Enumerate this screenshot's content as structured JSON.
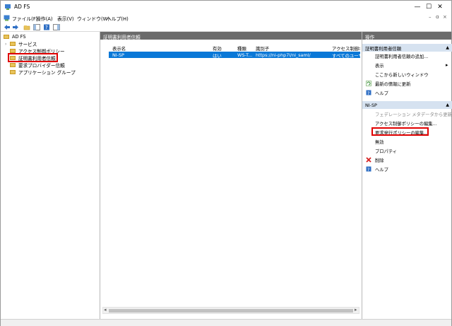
{
  "window": {
    "title": "AD FS",
    "minimize_glyph": "—",
    "maximize_glyph": "☐",
    "close_glyph": "✕"
  },
  "menubar": {
    "items": [
      "ファイル(F)",
      "操作(A)",
      "表示(V)",
      "ウィンドウ(W)",
      "ヘルプ(H)"
    ],
    "mdi_minimize": "–",
    "mdi_restore": "ɑ",
    "mdi_close": "×"
  },
  "tree": {
    "root": "AD FS",
    "items": [
      {
        "label": "サービス",
        "expandable": true
      },
      {
        "label": "アクセス制御ポリシー",
        "expandable": false
      },
      {
        "label": "証明書利用者信頼",
        "expandable": false,
        "highlighted": true
      },
      {
        "label": "要求プロバイダー信頼",
        "expandable": false
      },
      {
        "label": "アプリケーション グループ",
        "expandable": false
      }
    ]
  },
  "center": {
    "title": "証明書利用者信頼",
    "columns": [
      "表示名",
      "有効",
      "種類",
      "識別子",
      "アクセス制御ポ"
    ],
    "rows": [
      {
        "name": "NI-SP",
        "enabled": "はい",
        "type": "WS-T...",
        "identifier": "https://ni-php7l/ni_saml/",
        "access": "すべてのユーザ"
      }
    ],
    "scroll_left": "◂",
    "scroll_right": "▸"
  },
  "actions": {
    "header": "操作",
    "section1": {
      "title": "証明書利用者信頼",
      "items": [
        {
          "label": "証明書利用者信頼の追加...",
          "icon": ""
        },
        {
          "label": "表示",
          "icon": "",
          "submenu": true
        },
        {
          "label": "ここから新しいウィンドウ",
          "icon": ""
        },
        {
          "label": "最新の情報に更新",
          "icon": "refresh-icon"
        },
        {
          "label": "ヘルプ",
          "icon": "help-icon"
        }
      ]
    },
    "section2": {
      "title": "NI-SP",
      "items": [
        {
          "label": "フェデレーション メタデータから更新...",
          "icon": "",
          "disabled": true
        },
        {
          "label": "アクセス制御ポリシーの編集...",
          "icon": ""
        },
        {
          "label": "要求発行ポリシーの編集...",
          "icon": "",
          "highlighted": true
        },
        {
          "label": "無効",
          "icon": ""
        },
        {
          "label": "プロパティ",
          "icon": ""
        },
        {
          "label": "削除",
          "icon": "delete-icon"
        },
        {
          "label": "ヘルプ",
          "icon": "help-icon"
        }
      ]
    },
    "collapse_glyph": "▲",
    "submenu_glyph": "▸"
  },
  "colors": {
    "selection": "#0a78d7",
    "pane_header": "#6b6b6b",
    "section_header": "#d6e2f0",
    "highlight_border": "#e00000"
  }
}
